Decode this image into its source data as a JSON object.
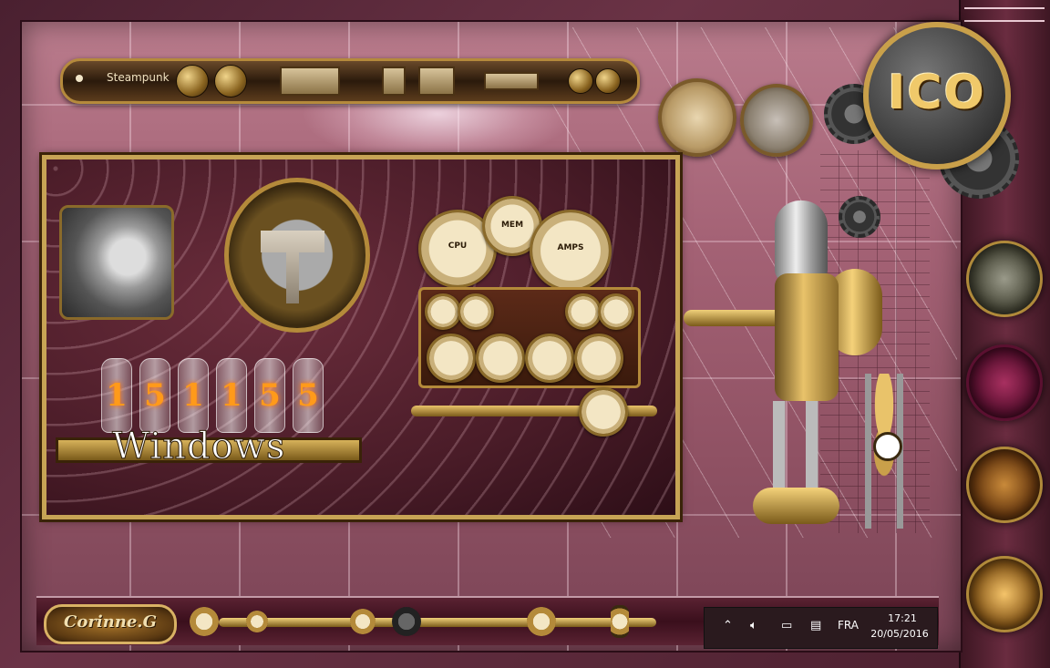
{
  "toolbar": {
    "label": "Steampunk"
  },
  "logo": {
    "text": "ICO"
  },
  "desktop": {
    "clock_digits": [
      "1",
      "5",
      "1",
      "1",
      "5",
      "5"
    ],
    "os_text": "Windows"
  },
  "gauges": {
    "cpu_label": "CPU",
    "mem_label": "MEM",
    "amps_label": "AMPS"
  },
  "taskbar": {
    "signature": "Corinne.G",
    "tray": {
      "language": "FRA",
      "time": "17:21",
      "date": "20/05/2016",
      "chevron_icon": "chevron-up-icon",
      "volume_icon": "speaker-icon",
      "network_icon": "network-icon",
      "notification_icon": "notification-icon"
    }
  },
  "colors": {
    "frame": "#a46275",
    "gold": "#c9a04a",
    "taskbar": "#3a0f1c"
  }
}
